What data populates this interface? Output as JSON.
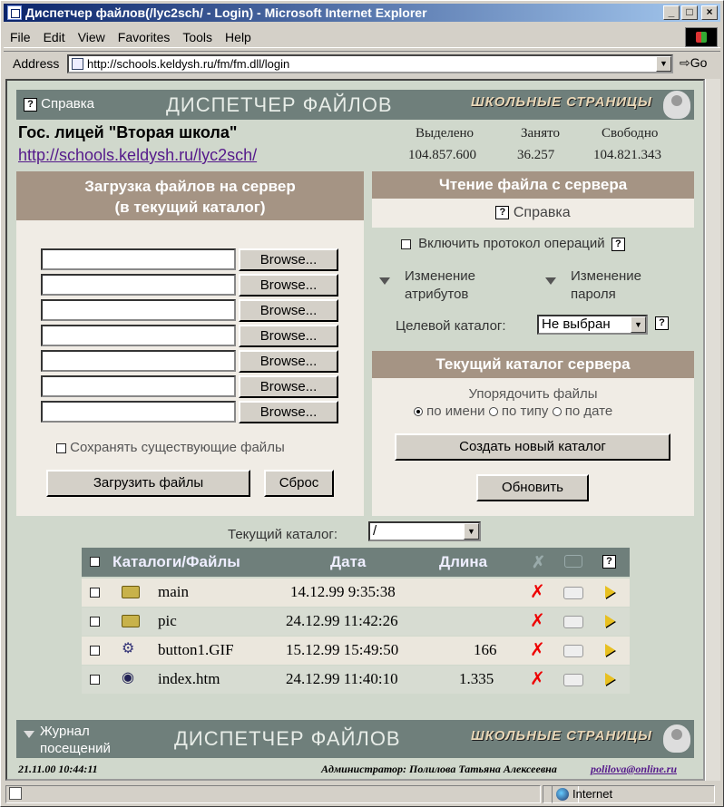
{
  "window": {
    "title": "Диспетчер файлов(/lyc2sch/ - Login) - Microsoft Internet Explorer"
  },
  "menu": [
    "File",
    "Edit",
    "View",
    "Favorites",
    "Tools",
    "Help"
  ],
  "address": {
    "label": "Address",
    "url": "http://schools.keldysh.ru/fm/fm.dll/login",
    "go": "Go"
  },
  "header": {
    "help": "Справка",
    "title": "ДИСПЕТЧЕР ФАЙЛОВ",
    "logo": "ШКОЛЬНЫЕ СТРАНИЦЫ"
  },
  "school": {
    "name": "Гос. лицей \"Вторая школа\"",
    "url": "http://schools.keldysh.ru/lyc2sch/"
  },
  "quota": {
    "allocated_label": "Выделено",
    "used_label": "Занято",
    "free_label": "Свободно",
    "allocated": "104.857.600",
    "used": "36.257",
    "free": "104.821.343"
  },
  "upload": {
    "title1": "Загрузка файлов на сервер",
    "title2": "(в текущий каталог)",
    "browse": "Browse...",
    "keep": "Сохранять существующие файлы",
    "submit": "Загрузить файлы",
    "reset": "Сброс"
  },
  "read": {
    "title": "Чтение файла с сервера",
    "help": "Справка",
    "log": "Включить протокол операций",
    "attr1": "Изменение",
    "attr2": "атрибутов",
    "pwd1": "Изменение",
    "pwd2": "пароля",
    "target_label": "Целевой каталог:",
    "target_value": "Не выбран"
  },
  "current": {
    "title": "Текущий каталог сервера",
    "sort_label": "Упорядочить файлы",
    "by_name": "по имени",
    "by_type": "по типу",
    "by_date": "по дате",
    "new_dir": "Создать новый каталог",
    "refresh": "Обновить"
  },
  "dir": {
    "label": "Текущий каталог:",
    "value": "/"
  },
  "table": {
    "col_name": "Каталоги/Файлы",
    "col_date": "Дата",
    "col_len": "Длина",
    "rows": [
      {
        "name": "main",
        "date": "14.12.99 9:35:38",
        "len": "",
        "type": "folder"
      },
      {
        "name": "pic",
        "date": "24.12.99 11:42:26",
        "len": "",
        "type": "folder"
      },
      {
        "name": "button1.GIF",
        "date": "15.12.99 15:49:50",
        "len": "166",
        "type": "gif"
      },
      {
        "name": "index.htm",
        "date": "24.12.99 11:40:10",
        "len": "1.335",
        "type": "htm"
      }
    ]
  },
  "footer": {
    "journal1": "Журнал",
    "journal2": "посещений",
    "title": "ДИСПЕТЧЕР ФАЙЛОВ",
    "logo": "ШКОЛЬНЫЕ СТРАНИЦЫ",
    "date": "21.11.00 10:44:11",
    "admin": "Администратор: Полилова Татьяна Алексеевна",
    "email": "polilova@online.ru"
  },
  "status": {
    "zone": "Internet"
  }
}
